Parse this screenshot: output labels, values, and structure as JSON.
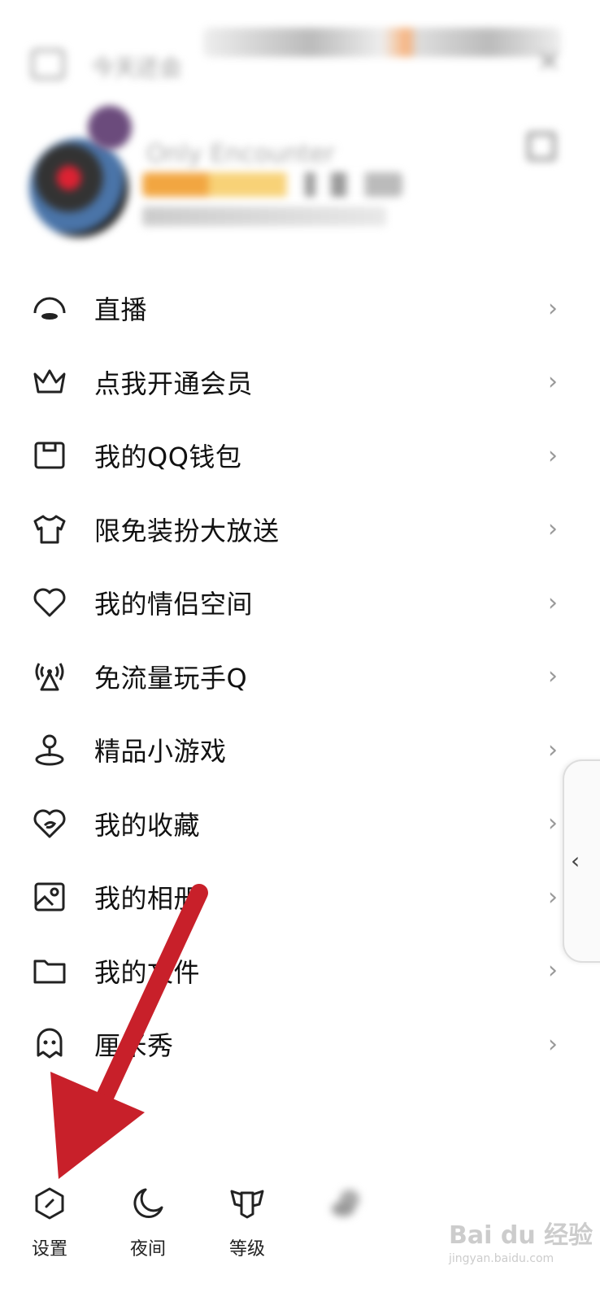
{
  "header": {
    "title": "今天还会",
    "close": "×"
  },
  "profile": {
    "name": "Only Encounter"
  },
  "menu": [
    {
      "label": "直播",
      "icon": "live-icon"
    },
    {
      "label": "点我开通会员",
      "icon": "crown-icon"
    },
    {
      "label": "我的QQ钱包",
      "icon": "wallet-icon"
    },
    {
      "label": "限免装扮大放送",
      "icon": "tshirt-icon"
    },
    {
      "label": "我的情侣空间",
      "icon": "heart-icon"
    },
    {
      "label": "免流量玩手Q",
      "icon": "antenna-icon"
    },
    {
      "label": "精品小游戏",
      "icon": "game-pin-icon"
    },
    {
      "label": "我的收藏",
      "icon": "favorite-heart-icon"
    },
    {
      "label": "我的相册",
      "icon": "photo-icon"
    },
    {
      "label": "我的文件",
      "icon": "folder-icon"
    },
    {
      "label": "厘米秀",
      "icon": "ghost-icon"
    }
  ],
  "chevron": "›",
  "side_handle": "‹",
  "bottom": [
    {
      "label": "设置",
      "icon": "settings-icon"
    },
    {
      "label": "夜间",
      "icon": "moon-icon"
    },
    {
      "label": "等级",
      "icon": "level-icon"
    },
    {
      "label": "",
      "icon": "weather-icon"
    }
  ],
  "watermark": {
    "brand": "Bai du 经验",
    "url": "jingyan.baidu.com"
  }
}
